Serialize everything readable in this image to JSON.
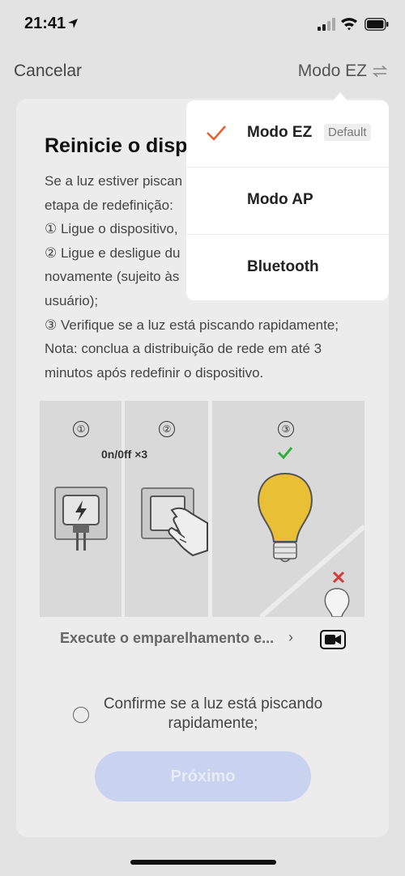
{
  "status_bar": {
    "time": "21:41"
  },
  "nav": {
    "cancel_label": "Cancelar",
    "mode_label": "Modo EZ"
  },
  "card": {
    "title": "Reinicie o disp",
    "instructions": [
      "Se a luz estiver piscan",
      "etapa de redefinição:",
      "① Ligue o dispositivo,",
      "② Ligue e desligue du",
      "novamente (sujeito às",
      "usuário);",
      "③ Verifique se a luz está piscando rapidamente;",
      "Nota: conclua a distribuição de rede em até 3",
      "minutos após redefinir o dispositivo."
    ],
    "steps": [
      {
        "num": "①"
      },
      {
        "num": "②",
        "caption": "0n/0ff ×3"
      },
      {
        "num": "③"
      }
    ],
    "execute_label": "Execute o emparelhamento e...",
    "chevron": "›",
    "confirm_label": "Confirme se a luz está piscando rapidamente;",
    "next_label": "Próximo"
  },
  "dropdown": {
    "items": [
      {
        "label": "Modo EZ",
        "badge": "Default",
        "selected": true
      },
      {
        "label": "Modo AP",
        "selected": false
      },
      {
        "label": "Bluetooth",
        "selected": false
      }
    ]
  },
  "colors": {
    "accent_check": "#e7602f",
    "success_check": "#2fae3a",
    "fail_x": "#d43b34",
    "button_disabled": "#c9d2ef",
    "bulb": "#e8bf35"
  }
}
